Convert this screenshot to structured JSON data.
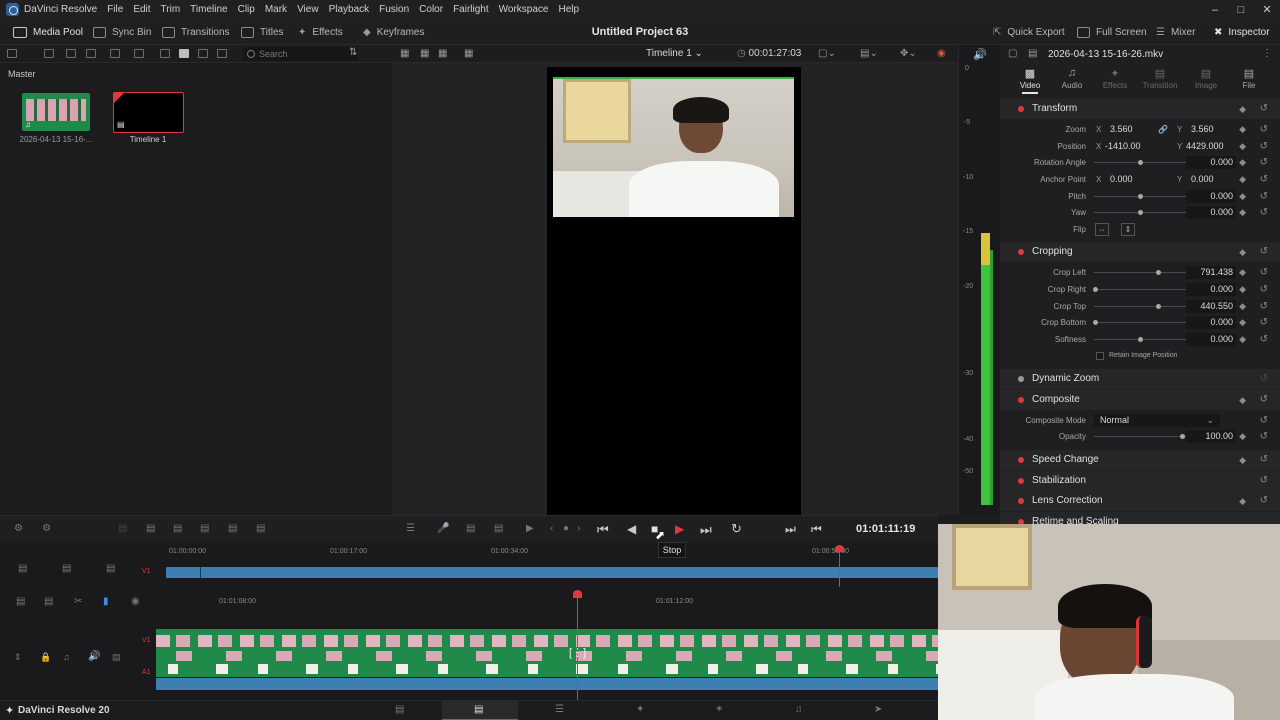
{
  "app": {
    "name": "DavinciResolve",
    "menu": [
      "DaVinci Resolve",
      "File",
      "Edit",
      "Trim",
      "Timeline",
      "Clip",
      "Mark",
      "View",
      "Playback",
      "Fusion",
      "Color",
      "Fairlight",
      "Workspace",
      "Help"
    ]
  },
  "toolbar": {
    "media_pool": "Media Pool",
    "sync_bin": "Sync Bin",
    "transitions": "Transitions",
    "titles": "Titles",
    "effects": "Effects",
    "keyframes": "Keyframes",
    "project_title": "Untitled Project 63",
    "quick_export": "Quick Export",
    "full_screen": "Full Screen",
    "mixer": "Mixer",
    "inspector": "Inspector"
  },
  "media_pool": {
    "search_placeholder": "Search",
    "bin": "Master",
    "clips": [
      {
        "label": "2026-04-13 15-16-..."
      },
      {
        "label": "Timeline 1"
      }
    ]
  },
  "viewer": {
    "timeline_name": "Timeline 1",
    "duration": "00:01:27:03"
  },
  "meters": {
    "ticks": [
      "0",
      "-5",
      "-10",
      "-15",
      "-20",
      "-30",
      "-40",
      "-50"
    ]
  },
  "inspector": {
    "clip_name": "2026-04-13 15-16-26.mkv",
    "tabs": [
      "Video",
      "Audio",
      "Effects",
      "Transition",
      "Image",
      "File"
    ],
    "transform": {
      "title": "Transform",
      "zoom_label": "Zoom",
      "zoom_x": "3.560",
      "zoom_y": "3.560",
      "position_label": "Position",
      "position_x": "-1410.00",
      "position_y": "4429.000",
      "rotation_label": "Rotation Angle",
      "rotation": "0.000",
      "anchor_label": "Anchor Point",
      "anchor_x": "0.000",
      "anchor_y": "0.000",
      "pitch_label": "Pitch",
      "pitch": "0.000",
      "yaw_label": "Yaw",
      "yaw": "0.000",
      "flip_label": "Flip"
    },
    "cropping": {
      "title": "Cropping",
      "left_label": "Crop Left",
      "left": "791.438",
      "right_label": "Crop Right",
      "right": "0.000",
      "top_label": "Crop Top",
      "top": "440.550",
      "bottom_label": "Crop Bottom",
      "bottom": "0.000",
      "softness_label": "Softness",
      "softness": "0.000",
      "retain_label": "Retain Image Position"
    },
    "dynamic_zoom": "Dynamic Zoom",
    "composite": {
      "title": "Composite",
      "mode_label": "Composite Mode",
      "mode": "Normal",
      "opacity_label": "Opacity",
      "opacity": "100.00"
    },
    "speed_change": "Speed Change",
    "stabilization": "Stabilization",
    "lens_correction": "Lens Correction",
    "retime": "Retime and Scaling"
  },
  "transport": {
    "timecode": "01:01:11:19",
    "tooltip": "Stop"
  },
  "timeline": {
    "upper_ticks": [
      "01:00:00:00",
      "01:00:17:00",
      "01:00:34:00",
      "01:00:51:00",
      "01:01:08:00"
    ],
    "lower_ticks": [
      "01:01:08:00",
      "01:01:12:00"
    ],
    "track_v1": "V1",
    "track_a1": "A1"
  },
  "bottom": {
    "product": "DaVinci Resolve 20"
  },
  "colors": {
    "accent_red": "#e0383c",
    "clip_green": "#1f8a4a",
    "clip_blue": "#3c7fb0",
    "meter_green": "#3fc43f"
  }
}
